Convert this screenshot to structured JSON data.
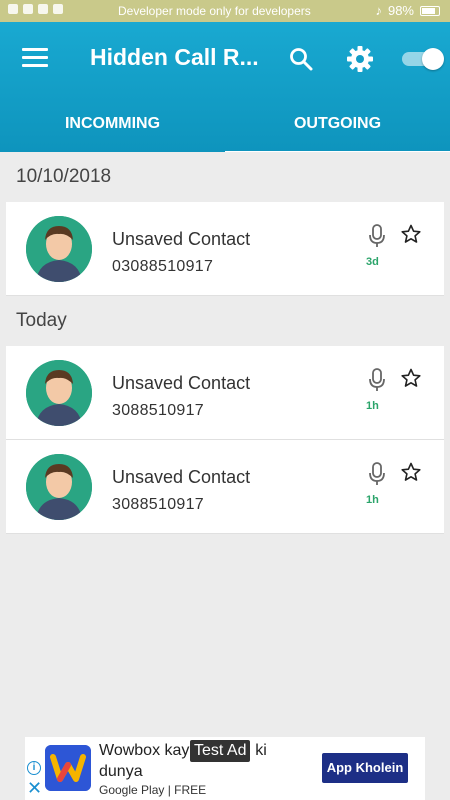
{
  "status_bar": {
    "notice": "Developer mode only for developers",
    "battery": "98%"
  },
  "app_bar": {
    "title": "Hidden Call R...",
    "toggle_on": true
  },
  "tabs": [
    {
      "label": "INCOMMING",
      "active": false
    },
    {
      "label": "OUTGOING",
      "active": true
    }
  ],
  "groups": [
    {
      "date": "10/10/2018",
      "calls": [
        {
          "name": "Unsaved Contact",
          "number": "03088510917",
          "time": "3d"
        }
      ]
    },
    {
      "date": "Today",
      "calls": [
        {
          "name": "Unsaved Contact",
          "number": "3088510917",
          "time": "1h"
        },
        {
          "name": "Unsaved Contact",
          "number": "3088510917",
          "time": "1h"
        }
      ]
    }
  ],
  "ad": {
    "title": "Wowbox kay sath Aaj ki dunya",
    "badge": "Test Ad",
    "store": "Google Play",
    "price": "FREE",
    "button": "App Kholein",
    "info": "i",
    "close": "✕"
  },
  "colors": {
    "app_bar": "#129dc6",
    "avatar_bg": "#2aa583",
    "time_text": "#2ba46a",
    "ad_button": "#1d2f86"
  }
}
